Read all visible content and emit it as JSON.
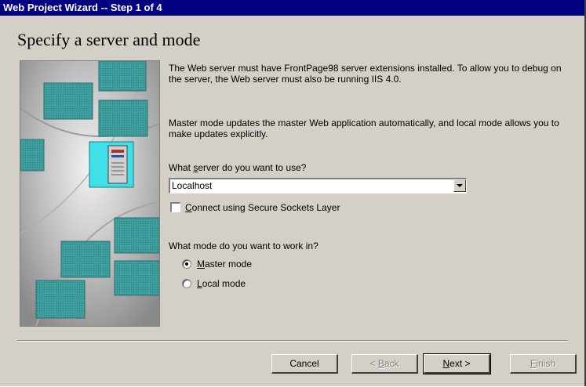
{
  "window": {
    "title": "Web Project Wizard -- Step 1 of 4",
    "heading": "Specify a server and mode"
  },
  "body": {
    "paragraph1": "The Web server must have FrontPage98 server extensions installed. To allow you to debug on the server, the Web server must also be running IIS 4.0.",
    "paragraph2": "Master mode updates the master Web application automatically, and local mode allows you to make updates explicitly."
  },
  "server": {
    "label_pre": "What ",
    "label_accel": "s",
    "label_post": "erver do you want to use?",
    "value": "Localhost",
    "dropdown_icon": "down-arrow"
  },
  "ssl": {
    "label_accel": "C",
    "label_post": "onnect using Secure Sockets Layer",
    "checked": false
  },
  "mode": {
    "label": "What mode do you want to work in?",
    "master_accel": "M",
    "master_post": "aster mode",
    "local_accel": "L",
    "local_post": "ocal mode",
    "selected": "master"
  },
  "buttons": {
    "cancel": "Cancel",
    "back_pre": "< ",
    "back_accel": "B",
    "back_post": "ack",
    "next_accel": "N",
    "next_post": "ext >",
    "finish_accel": "F",
    "finish_post": "inish"
  },
  "colors": {
    "title_bg": "#000080",
    "dialog_bg": "#d4d0c8",
    "art_panel": "#3a9a9a"
  }
}
